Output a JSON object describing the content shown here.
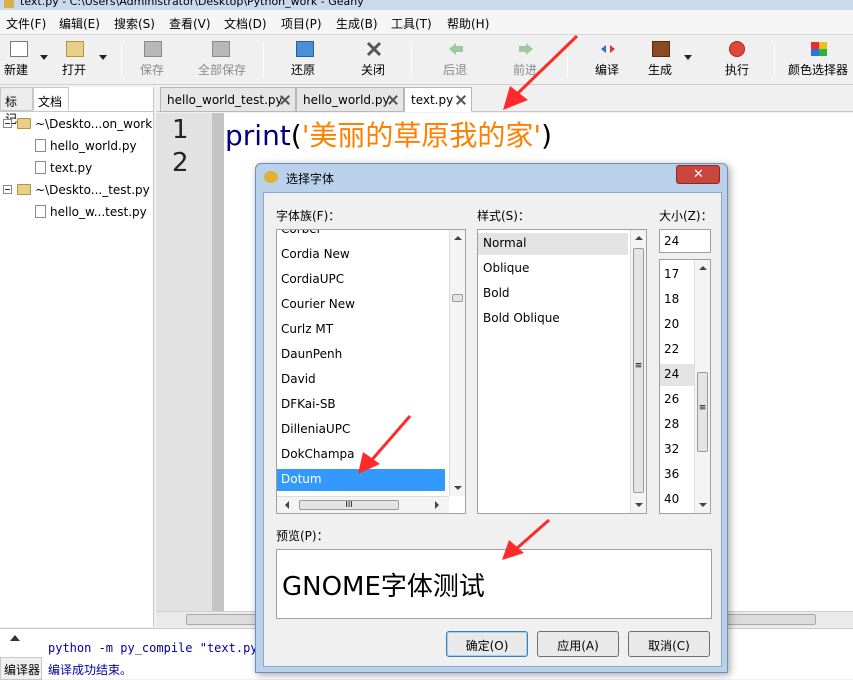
{
  "window": {
    "title": "text.py - C:\\Users\\Administrator\\Desktop\\Python_work - Geany"
  },
  "menu": [
    "文件(F)",
    "编辑(E)",
    "搜索(S)",
    "查看(V)",
    "文档(D)",
    "项目(P)",
    "生成(B)",
    "工具(T)",
    "帮助(H)"
  ],
  "toolbar": {
    "new": "新建",
    "open": "打开",
    "save": "保存",
    "save_all": "全部保存",
    "revert": "还原",
    "close": "关闭",
    "back": "后退",
    "forward": "前进",
    "compile": "编译",
    "build": "生成",
    "execute": "执行",
    "color_chooser": "颜色选择器"
  },
  "sidebar": {
    "tabs": [
      "标记",
      "文档"
    ],
    "tree": [
      {
        "label": "~\\Deskto...on_work",
        "type": "folder"
      },
      {
        "label": "hello_world.py",
        "type": "file"
      },
      {
        "label": "text.py",
        "type": "file"
      },
      {
        "label": "~\\Deskto..._test.py",
        "type": "folder"
      },
      {
        "label": "hello_w...test.py",
        "type": "file"
      }
    ]
  },
  "editor": {
    "tabs": [
      "hello_world_test.py",
      "hello_world.py",
      "text.py"
    ],
    "line_numbers": [
      "1",
      "2"
    ],
    "code": {
      "fn": "print",
      "open": "(",
      "str": "'美丽的草原我的家'",
      "close": ")"
    }
  },
  "messages": {
    "tab": "编译器",
    "line1": "python -m py_compile \"text.py\"",
    "line2": "编译成功结束。"
  },
  "dialog": {
    "title": "选择字体",
    "family_label": "字体族(F)：",
    "style_label": "样式(S)：",
    "size_label": "大小(Z)：",
    "families": [
      "Corbel",
      "Cordia New",
      "CordiaUPC",
      "Courier New",
      "Curlz MT",
      "DaunPenh",
      "David",
      "DFKai-SB",
      "DilleniaUPC",
      "DokChampa",
      "Dotum"
    ],
    "selected_family": "Dotum",
    "styles": [
      "Normal",
      "Oblique",
      "Bold",
      "Bold Oblique"
    ],
    "selected_style": "Normal",
    "size_value": "24",
    "sizes": [
      "17",
      "18",
      "20",
      "22",
      "24",
      "26",
      "28",
      "32",
      "36",
      "40"
    ],
    "selected_size": "24",
    "preview_label": "预览(P)：",
    "preview_text": "GNOME字体测试",
    "ok": "确定(O)",
    "apply": "应用(A)",
    "cancel": "取消(C)",
    "close_glyph": "✕",
    "hscroll_grip": "III",
    "vgrip": "≡"
  },
  "colors": {
    "accent_selection": "#3399ff",
    "string": "#ff8000",
    "keyword": "#000080",
    "arrow": "#ff2a2a"
  }
}
